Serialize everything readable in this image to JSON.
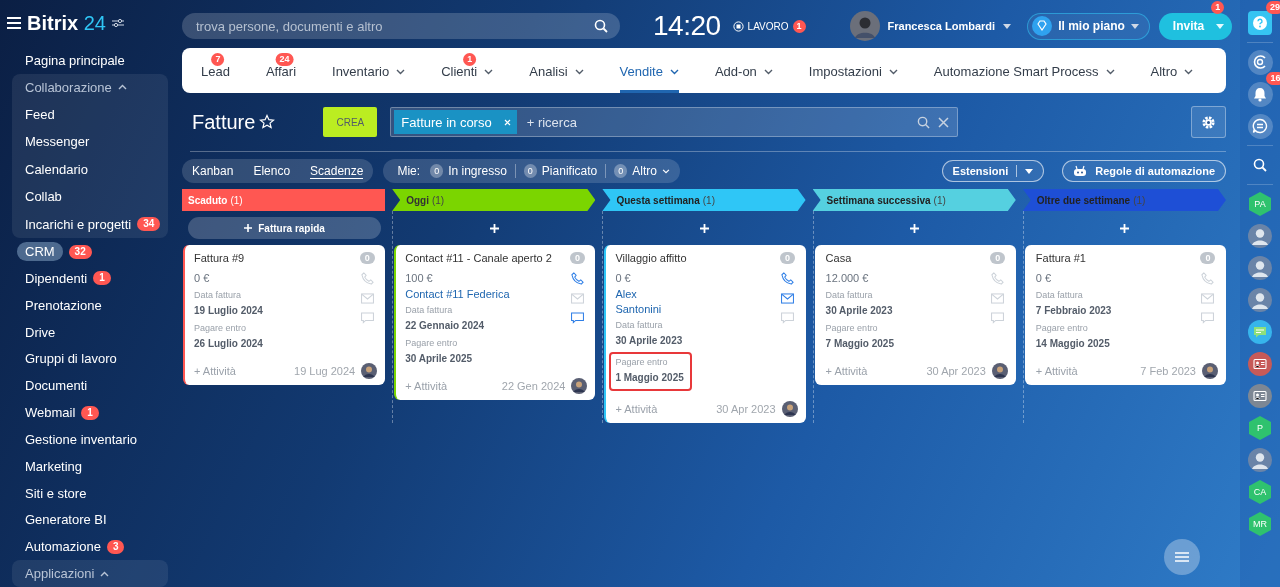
{
  "logo": {
    "name": "Bitrix",
    "suffix": "24"
  },
  "search": {
    "placeholder": "trova persone, documenti e altro"
  },
  "clock": {
    "time": "14:20",
    "status": "LAVORO",
    "badge": "1"
  },
  "user": {
    "name": "Francesca Lombardi"
  },
  "plan": {
    "label": "Il mio piano"
  },
  "invite": {
    "label": "Invita",
    "badge": "1"
  },
  "sidebar": {
    "items": [
      {
        "kind": "item",
        "label": "Pagina principale",
        "selected": false
      },
      {
        "kind": "group",
        "label": "Collaborazione",
        "expanded": true,
        "children": [
          {
            "label": "Feed"
          },
          {
            "label": "Messenger"
          },
          {
            "label": "Calendario"
          },
          {
            "label": "Collab"
          },
          {
            "label": "Incarichi e progetti",
            "badge": "34"
          }
        ]
      },
      {
        "kind": "item",
        "label": "CRM",
        "badge": "32",
        "selected": true
      },
      {
        "kind": "item",
        "label": "Dipendenti",
        "badge": "1",
        "selected": false
      },
      {
        "kind": "item",
        "label": "Prenotazione",
        "selected": false
      },
      {
        "kind": "item",
        "label": "Drive",
        "selected": false
      },
      {
        "kind": "item",
        "label": "Gruppi di lavoro",
        "selected": false
      },
      {
        "kind": "item",
        "label": "Documenti",
        "selected": false
      },
      {
        "kind": "item",
        "label": "Webmail",
        "badge": "1",
        "selected": false
      },
      {
        "kind": "item",
        "label": "Gestione inventario",
        "selected": false
      },
      {
        "kind": "item",
        "label": "Marketing",
        "selected": false
      },
      {
        "kind": "item",
        "label": "Siti e store",
        "selected": false
      },
      {
        "kind": "item",
        "label": "Generatore BI",
        "selected": false
      },
      {
        "kind": "item",
        "label": "Automazione",
        "badge": "3",
        "selected": false
      },
      {
        "kind": "group",
        "label": "Applicazioni",
        "expanded": true
      }
    ]
  },
  "nav": {
    "tabs": [
      {
        "label": "Lead",
        "badge": "7",
        "dropdown": false,
        "selected": false
      },
      {
        "label": "Affari",
        "badge": "24",
        "dropdown": false,
        "selected": false
      },
      {
        "label": "Inventario",
        "dropdown": true,
        "selected": false
      },
      {
        "label": "Clienti",
        "badge": "1",
        "dropdown": true,
        "selected": false
      },
      {
        "label": "Analisi",
        "dropdown": true,
        "selected": false
      },
      {
        "label": "Vendite",
        "dropdown": true,
        "selected": true
      },
      {
        "label": "Add-on",
        "dropdown": true,
        "selected": false
      },
      {
        "label": "Impostazioni",
        "dropdown": true,
        "selected": false
      },
      {
        "label": "Automazione Smart Process",
        "dropdown": true,
        "selected": false
      },
      {
        "label": "Altro",
        "dropdown": true,
        "selected": false
      }
    ]
  },
  "page": {
    "title": "Fatture",
    "create": "CREA",
    "filter": {
      "tag": "Fatture in corso",
      "placeholder": "+ ricerca"
    }
  },
  "views": [
    {
      "label": "Kanban",
      "selected": false
    },
    {
      "label": "Elenco",
      "selected": false
    },
    {
      "label": "Scadenze",
      "selected": true
    }
  ],
  "mine": {
    "label": "Mie:",
    "counters": [
      {
        "count": "0",
        "label": "In ingresso",
        "dropdown": false
      },
      {
        "count": "0",
        "label": "Pianificato",
        "dropdown": false
      },
      {
        "count": "0",
        "label": "Altro",
        "dropdown": true
      }
    ]
  },
  "extensions": {
    "label": "Estensioni"
  },
  "automation": {
    "label": "Regole di automazione"
  },
  "columns": [
    {
      "title": "Scaduto",
      "count": "(1)",
      "color": "#ff5752",
      "add": "Fattura rapida",
      "card_accent": true,
      "cards": [
        {
          "title": "Fattura #9",
          "amount": "0 €",
          "counter": "0",
          "phone": false,
          "mail": false,
          "chat": false,
          "fields": [
            {
              "label": "Data fattura",
              "value": "19 Luglio 2024",
              "highlighted": false
            },
            {
              "label": "Pagare entro",
              "value": "26 Luglio 2024",
              "highlighted": false
            }
          ],
          "activity": "+ Attività",
          "date": "19 Lug 2024"
        }
      ]
    },
    {
      "title": "Oggi",
      "count": "(1)",
      "color": "#7bd500",
      "card_accent": true,
      "cards": [
        {
          "title": "Contact #11 - Canale aperto 2",
          "amount": "100 €",
          "counter": "0",
          "contact": [
            "Contact #11 Federica"
          ],
          "phone": true,
          "mail": false,
          "chat": true,
          "fields": [
            {
              "label": "Data fattura",
              "value": "22 Gennaio 2024",
              "highlighted": false
            },
            {
              "label": "Pagare entro",
              "value": "30 Aprile 2025",
              "highlighted": false
            }
          ],
          "activity": "+ Attività",
          "date": "22 Gen 2024"
        }
      ]
    },
    {
      "title": "Questa settimana",
      "count": "(1)",
      "color": "#2fc6f6",
      "card_accent": true,
      "cards": [
        {
          "title": "Villaggio affitto",
          "amount": "0 €",
          "counter": "0",
          "contact": [
            "Alex",
            "Santonini"
          ],
          "phone": true,
          "mail": true,
          "chat": false,
          "fields": [
            {
              "label": "Data fattura",
              "value": "30 Aprile 2023",
              "highlighted": false
            },
            {
              "label": "Pagare entro",
              "value": "1 Maggio 2025",
              "highlighted": true
            }
          ],
          "activity": "+ Attività",
          "date": "30 Apr 2023"
        }
      ]
    },
    {
      "title": "Settimana successiva",
      "count": "(1)",
      "color": "#55d0e0",
      "card_accent": false,
      "cards": [
        {
          "title": "Casa",
          "amount": "12.000 €",
          "counter": "0",
          "phone": false,
          "mail": false,
          "chat": false,
          "fields": [
            {
              "label": "Data fattura",
              "value": "30 Aprile 2023",
              "highlighted": false
            },
            {
              "label": "Pagare entro",
              "value": "7 Maggio 2025",
              "highlighted": false
            }
          ],
          "activity": "+ Attività",
          "date": "30 Apr 2023"
        }
      ]
    },
    {
      "title": "Oltre due settimane",
      "count": "(1)",
      "color": "#1e4fd6",
      "card_accent": false,
      "cards": [
        {
          "title": "Fattura #1",
          "amount": "0 €",
          "counter": "0",
          "phone": false,
          "mail": false,
          "chat": false,
          "fields": [
            {
              "label": "Data fattura",
              "value": "7 Febbraio 2023",
              "highlighted": false
            },
            {
              "label": "Pagare entro",
              "value": "14 Maggio 2025",
              "highlighted": false
            }
          ],
          "activity": "+ Attività",
          "date": "7 Feb 2023"
        }
      ]
    }
  ],
  "rail": [
    {
      "kind": "help",
      "badge": "29"
    },
    {
      "kind": "copilot"
    },
    {
      "kind": "bell",
      "badge": "16"
    },
    {
      "kind": "chat-sync"
    },
    {
      "kind": "search"
    },
    {
      "kind": "initials",
      "initials": "PA",
      "color": "#2fc26e"
    },
    {
      "kind": "photo"
    },
    {
      "kind": "photo"
    },
    {
      "kind": "photo"
    },
    {
      "kind": "chat"
    },
    {
      "kind": "contact",
      "color": "#c65a58"
    },
    {
      "kind": "contact",
      "color": "#7d8794"
    },
    {
      "kind": "initials",
      "initials": "P",
      "color": "#2fc26e"
    },
    {
      "kind": "photo"
    },
    {
      "kind": "initials",
      "initials": "CA",
      "color": "#2fc26e"
    },
    {
      "kind": "initials",
      "initials": "MR",
      "color": "#2fc26e"
    }
  ]
}
